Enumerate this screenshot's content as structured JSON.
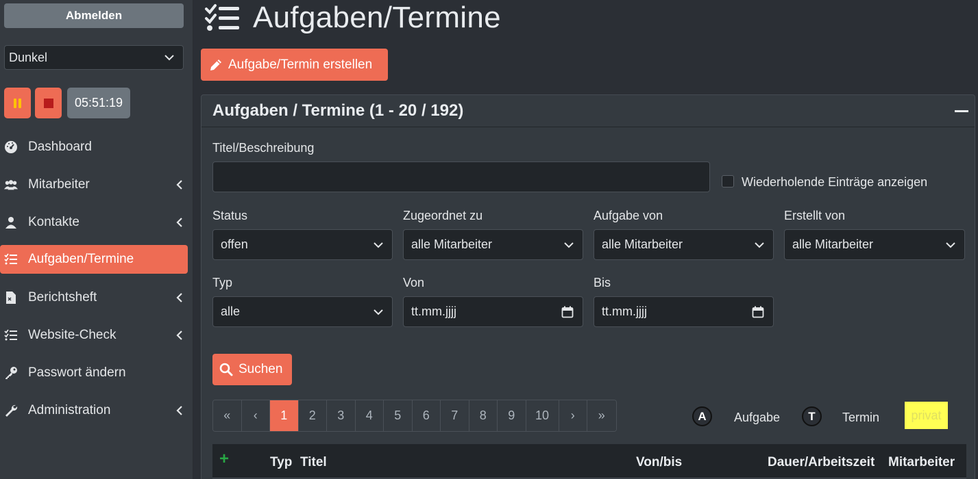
{
  "sidebar": {
    "logout_label": "Abmelden",
    "theme_value": "Dunkel",
    "timer": "05:51:19",
    "items": [
      {
        "label": "Dashboard",
        "icon": "dashboard-icon",
        "chevron": false
      },
      {
        "label": "Mitarbeiter",
        "icon": "users-icon",
        "chevron": true
      },
      {
        "label": "Kontakte",
        "icon": "contact-icon",
        "chevron": true
      },
      {
        "label": "Aufgaben/Termine",
        "icon": "tasks-icon",
        "chevron": false,
        "active": true
      },
      {
        "label": "Berichtsheft",
        "icon": "report-icon",
        "chevron": true
      },
      {
        "label": "Website-Check",
        "icon": "checklist-icon",
        "chevron": true
      },
      {
        "label": "Passwort ändern",
        "icon": "key-icon",
        "chevron": false
      },
      {
        "label": "Administration",
        "icon": "wrench-icon",
        "chevron": true
      }
    ]
  },
  "header": {
    "title": "Aufgaben/Termine",
    "create_label": "Aufgabe/Termin erstellen"
  },
  "card": {
    "title": "Aufgaben / Termine (1 - 20 / 192)",
    "filters": {
      "title_label": "Titel/Beschreibung",
      "title_value": "",
      "recurring_label": "Wiederholende Einträge anzeigen",
      "status_label": "Status",
      "status_value": "offen",
      "assigned_label": "Zugeordnet zu",
      "assigned_value": "alle Mitarbeiter",
      "task_from_label": "Aufgabe von",
      "task_from_value": "alle Mitarbeiter",
      "created_by_label": "Erstellt von",
      "created_by_value": "alle Mitarbeiter",
      "type_label": "Typ",
      "type_value": "alle",
      "from_label": "Von",
      "from_value": "tt.mm.jjjj",
      "to_label": "Bis",
      "to_value": "tt.mm.jjjj",
      "search_label": "Suchen"
    },
    "pagination": {
      "first": "«",
      "prev": "‹",
      "pages": [
        "1",
        "2",
        "3",
        "4",
        "5",
        "6",
        "7",
        "8",
        "9",
        "10"
      ],
      "active": "1",
      "next": "›",
      "last": "»"
    },
    "legend": {
      "task_letter": "A",
      "task_label": "Aufgabe",
      "appointment_letter": "T",
      "appointment_label": "Termin",
      "private_label": "privat"
    },
    "table": {
      "add_symbol": "+",
      "columns": [
        "Typ",
        "Titel",
        "Von/bis",
        "Dauer/Arbeitszeit",
        "Mitarbeiter"
      ]
    }
  },
  "colors": {
    "accent": "#ee6c54",
    "sidebar_bg": "#353a40",
    "page_bg": "#2b2f35",
    "private_highlight": "#ffff54"
  }
}
